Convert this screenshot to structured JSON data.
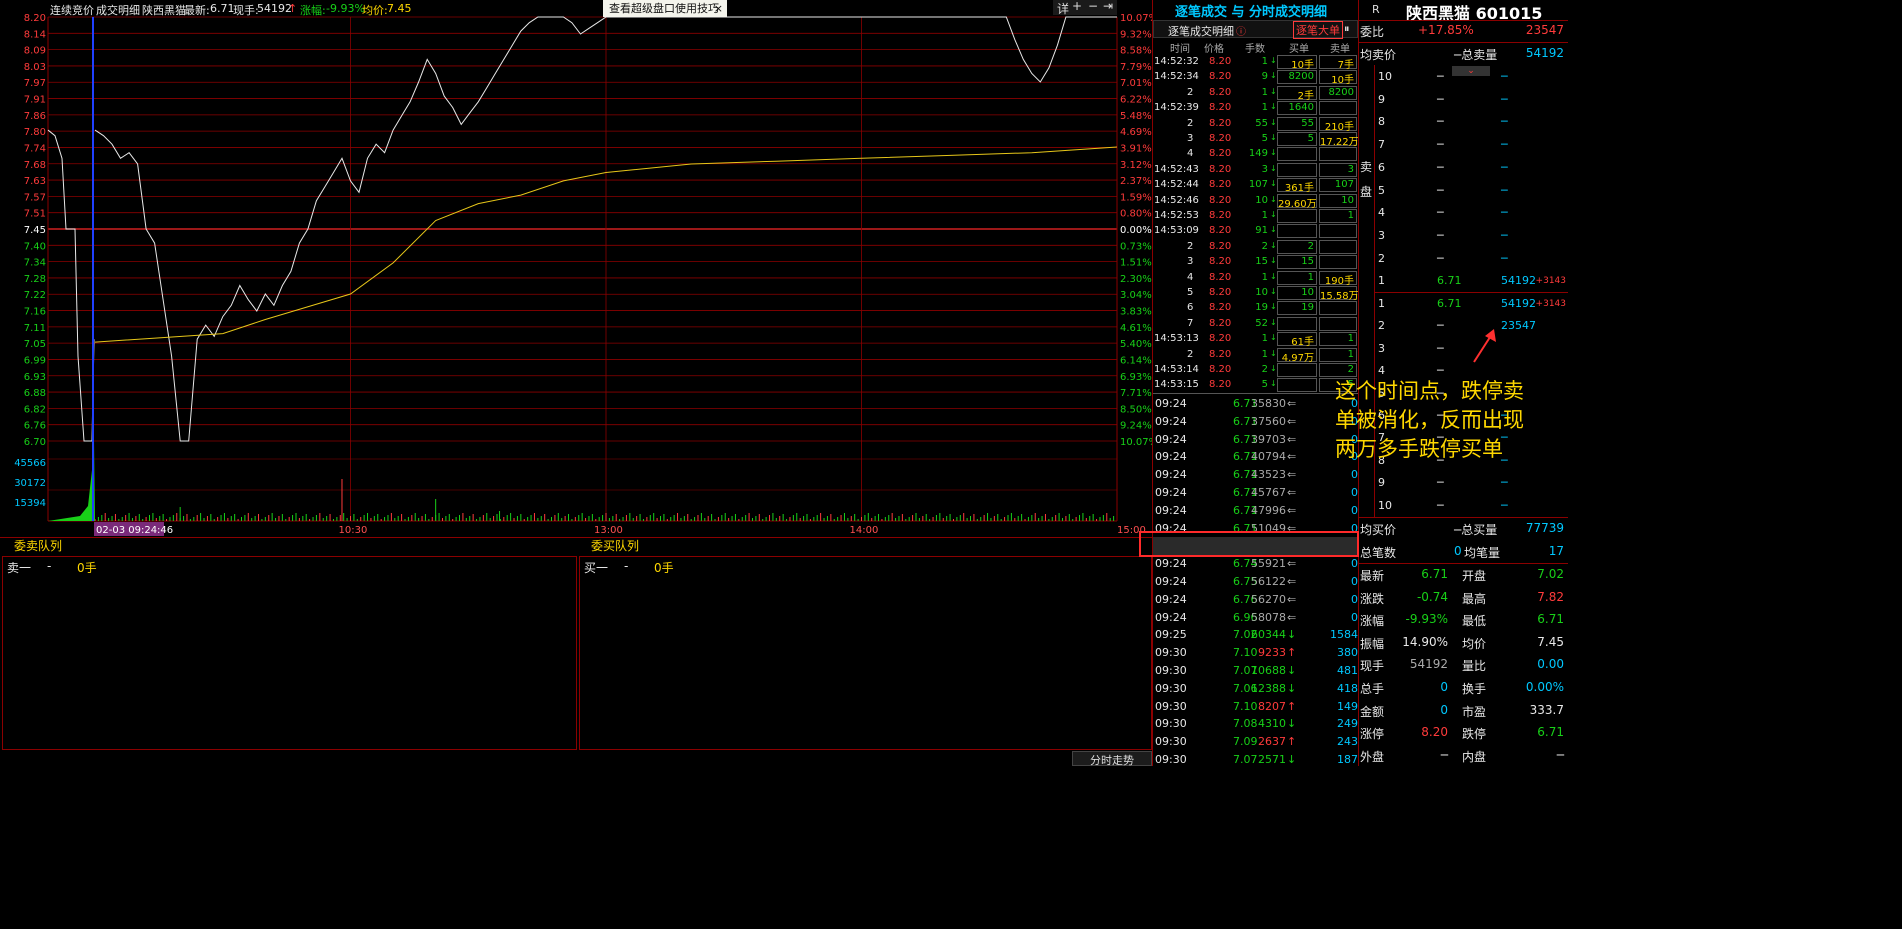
{
  "header": {
    "mode_label": "连续竞价",
    "detail_label": "成交明细",
    "stock_name": "陕西黑猫",
    "latest_label": "最新:",
    "latest_value": "6.71",
    "volume_label": "现手:",
    "volume_value": "54192",
    "change_label": "涨幅:",
    "change_value": "-9.93%",
    "avg_label": "均价:",
    "avg_value": "7.45",
    "tip_text": "查看超级盘口使用技巧",
    "tip_close": "×",
    "tool_detail": "详",
    "tool_plus": "+",
    "tool_minus": "−",
    "tool_expand": "⇥"
  },
  "colors": {
    "price_line": "#e8e8e8",
    "avg_line": "#e6c619",
    "grid": "#8b0000",
    "cursor": "#2040ff",
    "up": "#ff3b3b",
    "down": "#18d018"
  },
  "chart_data": {
    "type": "line",
    "title": "",
    "xlabel": "",
    "ylabel": "",
    "prev_close": 7.45,
    "ylim": [
      6.7,
      8.2
    ],
    "y_ticks": [
      "8.20",
      "8.14",
      "8.09",
      "8.03",
      "7.97",
      "7.91",
      "7.86",
      "7.80",
      "7.74",
      "7.68",
      "7.63",
      "7.57",
      "7.51",
      "7.45",
      "7.40",
      "7.34",
      "7.28",
      "7.22",
      "7.16",
      "7.11",
      "7.05",
      "6.99",
      "6.93",
      "6.88",
      "6.82",
      "6.76",
      "6.70"
    ],
    "pct_ticks": [
      "10.07%",
      "9.32%",
      "8.58%",
      "7.79%",
      "7.01%",
      "6.22%",
      "5.48%",
      "4.69%",
      "3.91%",
      "3.12%",
      "2.37%",
      "1.59%",
      "0.80%",
      "0.00%",
      "0.73%",
      "1.51%",
      "2.30%",
      "3.04%",
      "3.83%",
      "4.61%",
      "5.40%",
      "6.14%",
      "6.93%",
      "7.71%",
      "8.50%",
      "9.24%",
      "10.07%"
    ],
    "x_ticks": [
      "10:30",
      "13:00",
      "14:00",
      "15:00"
    ],
    "cursor_time": "02-03 09:24:46",
    "volume_ticks": [
      "45566",
      "30172",
      "15394"
    ],
    "series": [
      {
        "x": [
          0,
          2,
          4,
          6,
          8,
          10,
          12,
          14,
          16,
          18,
          20,
          22,
          24,
          26,
          28,
          30,
          32,
          34,
          36,
          38,
          40,
          42,
          44,
          46,
          48,
          50,
          52,
          54,
          56,
          58,
          60,
          62,
          64,
          66,
          68,
          70,
          72,
          74,
          76,
          78,
          80,
          82,
          84,
          86,
          88,
          90,
          92,
          94,
          96,
          98,
          100,
          102,
          104,
          106,
          108,
          110,
          112,
          114,
          116,
          118,
          120,
          122,
          124,
          126,
          128,
          130,
          132,
          134,
          136,
          138,
          140,
          142,
          144,
          146,
          148,
          150,
          152,
          154,
          156,
          158,
          160,
          162,
          164,
          166,
          168,
          170,
          172,
          174,
          176,
          178,
          180,
          182,
          184,
          186,
          188,
          190,
          192,
          194,
          196,
          198,
          200,
          202,
          204,
          206,
          208,
          210,
          212,
          214,
          216,
          218,
          220,
          222,
          224,
          226,
          228,
          230,
          232,
          234,
          236,
          238,
          240
        ],
        "values": [
          7.8,
          7.78,
          7.75,
          7.7,
          7.72,
          7.68,
          7.45,
          7.4,
          7.2,
          7.0,
          6.7,
          6.7,
          7.06,
          7.11,
          7.07,
          7.14,
          7.18,
          7.25,
          7.2,
          7.16,
          7.22,
          7.18,
          7.25,
          7.3,
          7.4,
          7.45,
          7.55,
          7.6,
          7.65,
          7.7,
          7.62,
          7.58,
          7.7,
          7.75,
          7.72,
          7.8,
          7.85,
          7.9,
          7.97,
          8.05,
          8.0,
          7.92,
          7.88,
          7.82,
          7.86,
          7.9,
          7.95,
          8.0,
          8.05,
          8.1,
          8.15,
          8.18,
          8.2,
          8.2,
          8.2,
          8.2,
          8.18,
          8.14,
          8.16,
          8.18,
          8.2,
          8.2,
          8.2,
          8.2,
          8.2,
          8.2,
          8.2,
          8.2,
          8.2,
          8.2,
          8.2,
          8.2,
          8.2,
          8.2,
          8.2,
          8.2,
          8.2,
          8.2,
          8.2,
          8.2,
          8.2,
          8.2,
          8.2,
          8.2,
          8.2,
          8.2,
          8.2,
          8.2,
          8.2,
          8.2,
          8.2,
          8.2,
          8.2,
          8.2,
          8.2,
          8.2,
          8.2,
          8.2,
          8.2,
          8.2,
          8.2,
          8.2,
          8.2,
          8.2,
          8.2,
          8.2,
          8.2,
          8.2,
          8.12,
          8.05,
          8.0,
          7.97,
          8.02,
          8.1,
          8.2,
          8.2,
          8.2,
          8.2,
          8.2,
          8.2,
          8.2
        ]
      },
      {
        "x": [
          0,
          30,
          40,
          60,
          70,
          80,
          90,
          100,
          110,
          120,
          140,
          160,
          180,
          200,
          220,
          240
        ],
        "values": [
          7.05,
          7.08,
          7.13,
          7.22,
          7.33,
          7.48,
          7.54,
          7.57,
          7.62,
          7.65,
          7.68,
          7.69,
          7.7,
          7.71,
          7.72,
          7.74
        ]
      }
    ]
  },
  "queues": {
    "sell_title": "委卖队列",
    "buy_title": "委买队列",
    "sell_line": {
      "label": "卖一",
      "dash": "-",
      "qty": "0手"
    },
    "buy_line": {
      "label": "买一",
      "dash": "-",
      "qty": "0手"
    }
  },
  "bottom_tab": "分时走势",
  "trades_panel": {
    "title": "逐笔成交 与 分时成交明细",
    "sub_title": "逐笔成交明细",
    "big_order": "逐笔大单",
    "cols": [
      "时间",
      "价格",
      "手数",
      "买单",
      "卖单"
    ],
    "rows": [
      {
        "t": "14:52:32",
        "p": "8.20",
        "q": "1"
      },
      {
        "t": "14:52:34",
        "p": "8.20",
        "q": "9"
      },
      {
        "t": "2",
        "p": "8.20",
        "q": "1"
      },
      {
        "t": "14:52:39",
        "p": "8.20",
        "q": "1"
      },
      {
        "t": "2",
        "p": "8.20",
        "q": "55"
      },
      {
        "t": "3",
        "p": "8.20",
        "q": "5"
      },
      {
        "t": "4",
        "p": "8.20",
        "q": "149"
      },
      {
        "t": "14:52:43",
        "p": "8.20",
        "q": "3"
      },
      {
        "t": "14:52:44",
        "p": "8.20",
        "q": "107"
      },
      {
        "t": "14:52:46",
        "p": "8.20",
        "q": "10"
      },
      {
        "t": "14:52:53",
        "p": "8.20",
        "q": "1"
      },
      {
        "t": "14:53:09",
        "p": "8.20",
        "q": "91"
      },
      {
        "t": "2",
        "p": "8.20",
        "q": "2"
      },
      {
        "t": "3",
        "p": "8.20",
        "q": "15"
      },
      {
        "t": "4",
        "p": "8.20",
        "q": "1"
      },
      {
        "t": "5",
        "p": "8.20",
        "q": "10"
      },
      {
        "t": "6",
        "p": "8.20",
        "q": "19"
      },
      {
        "t": "7",
        "p": "8.20",
        "q": "52"
      },
      {
        "t": "14:53:13",
        "p": "8.20",
        "q": "1"
      },
      {
        "t": "2",
        "p": "8.20",
        "q": "1"
      },
      {
        "t": "14:53:14",
        "p": "8.20",
        "q": "2"
      },
      {
        "t": "14:53:15",
        "p": "8.20",
        "q": "5"
      }
    ],
    "buy_col": [
      "10手",
      "8200",
      "2手",
      "1640",
      "55",
      "5",
      "",
      "",
      "361手",
      "29.60万",
      "",
      "",
      "2",
      "15",
      "1",
      "10",
      "19",
      "",
      "61手",
      "4.97万",
      "",
      ""
    ],
    "sell_col": [
      "7手",
      "10手",
      "8200",
      "",
      "210手",
      "17.22万",
      "",
      "3",
      "107",
      "10",
      "1",
      "",
      "",
      "",
      "190手",
      "15.58万",
      "",
      "",
      "1",
      "1",
      "2",
      "5"
    ]
  },
  "minute_trades": [
    {
      "t": "09:24",
      "p": "6.71",
      "v": "35830",
      "n": "0"
    },
    {
      "t": "09:24",
      "p": "6.71",
      "v": "37560",
      "n": "0"
    },
    {
      "t": "09:24",
      "p": "6.71",
      "v": "39703",
      "n": "0"
    },
    {
      "t": "09:24",
      "p": "6.71",
      "v": "40794",
      "n": "0"
    },
    {
      "t": "09:24",
      "p": "6.71",
      "v": "43523",
      "n": "0"
    },
    {
      "t": "09:24",
      "p": "6.71",
      "v": "45767",
      "n": "0"
    },
    {
      "t": "09:24",
      "p": "6.71",
      "v": "47996",
      "n": "0"
    },
    {
      "t": "09:24",
      "p": "6.71",
      "v": "51049",
      "n": "0"
    },
    {
      "t": "09:24",
      "p": "6.71",
      "v": "54192",
      "n": "0"
    },
    {
      "t": "09:24",
      "p": "6.74",
      "v": "55921",
      "n": "0"
    },
    {
      "t": "09:24",
      "p": "6.75",
      "v": "56122",
      "n": "0"
    },
    {
      "t": "09:24",
      "p": "6.76",
      "v": "56270",
      "n": "0"
    },
    {
      "t": "09:24",
      "p": "6.96",
      "v": "58078",
      "n": "0"
    },
    {
      "t": "09:25",
      "p": "7.02",
      "v": "60344",
      "n": "1584"
    },
    {
      "t": "09:30",
      "p": "7.10",
      "v": "9233",
      "n": "380"
    },
    {
      "t": "09:30",
      "p": "7.07",
      "v": "10688",
      "n": "481"
    },
    {
      "t": "09:30",
      "p": "7.06",
      "v": "12388",
      "n": "418"
    },
    {
      "t": "09:30",
      "p": "7.10",
      "v": "8207",
      "n": "149"
    },
    {
      "t": "09:30",
      "p": "7.08",
      "v": "4310",
      "n": "249"
    },
    {
      "t": "09:30",
      "p": "7.09",
      "v": "2637",
      "n": "243"
    },
    {
      "t": "09:30",
      "p": "7.07",
      "v": "2571",
      "n": "187"
    }
  ],
  "minute_dirs": [
    "l",
    "l",
    "l",
    "l",
    "l",
    "l",
    "l",
    "l",
    "l",
    "l",
    "l",
    "l",
    "l",
    "d",
    "u",
    "d",
    "d",
    "u",
    "d",
    "u",
    "d"
  ],
  "quote": {
    "r_label": "R",
    "name_code": "陕西黑猫 601015",
    "wb_label": "委比",
    "wb_pct": "+17.85%",
    "wb_diff": "23547",
    "avg_sell_label": "均卖价",
    "total_sell_label": "─总卖量",
    "total_sell_value": "54192",
    "sell_side_label": "卖",
    "sell_side_label2": "盘",
    "asks": [
      {
        "lv": "10",
        "p": "─",
        "v": "─"
      },
      {
        "lv": "9",
        "p": "─",
        "v": "─"
      },
      {
        "lv": "8",
        "p": "─",
        "v": "─"
      },
      {
        "lv": "7",
        "p": "─",
        "v": "─"
      },
      {
        "lv": "6",
        "p": "─",
        "v": "─"
      },
      {
        "lv": "5",
        "p": "─",
        "v": "─"
      },
      {
        "lv": "4",
        "p": "─",
        "v": "─"
      },
      {
        "lv": "3",
        "p": "─",
        "v": "─"
      },
      {
        "lv": "2",
        "p": "─",
        "v": "─"
      },
      {
        "lv": "1",
        "p": "6.71",
        "v": "54192",
        "c": "+3143"
      }
    ],
    "bids": [
      {
        "lv": "1",
        "p": "6.71",
        "v": "54192",
        "c": "+3143"
      },
      {
        "lv": "2",
        "p": "─",
        "v": "23547"
      },
      {
        "lv": "3",
        "p": "─",
        "v": ""
      },
      {
        "lv": "4",
        "p": "─",
        "v": ""
      },
      {
        "lv": "5",
        "p": "─",
        "v": ""
      },
      {
        "lv": "6",
        "p": "─",
        "v": "─"
      },
      {
        "lv": "7",
        "p": "─",
        "v": "─"
      },
      {
        "lv": "8",
        "p": "─",
        "v": "─"
      },
      {
        "lv": "9",
        "p": "─",
        "v": "─"
      },
      {
        "lv": "10",
        "p": "─",
        "v": "─"
      }
    ],
    "avg_buy_label": "均买价",
    "total_buy_label": "─总买量",
    "total_buy_value": "77739",
    "trade_count_label": "总笔数",
    "trade_count_value": "0",
    "avg_trade_label": "均笔量",
    "avg_trade_value": "17",
    "stats": [
      {
        "l1": "最新",
        "v1": "6.71",
        "l2": "开盘",
        "v2": "7.02"
      },
      {
        "l1": "涨跌",
        "v1": "-0.74",
        "l2": "最高",
        "v2": "7.82"
      },
      {
        "l1": "涨幅",
        "v1": "-9.93%",
        "l2": "最低",
        "v2": "6.71"
      },
      {
        "l1": "振幅",
        "v1": "14.90%",
        "l2": "均价",
        "v2": "7.45"
      },
      {
        "l1": "现手",
        "v1": "54192",
        "l2": "量比",
        "v2": "0.00"
      },
      {
        "l1": "总手",
        "v1": "0",
        "l2": "换手",
        "v2": "0.00%"
      },
      {
        "l1": "金额",
        "v1": "0",
        "l2": "市盈",
        "v2": "333.7"
      },
      {
        "l1": "涨停",
        "v1": "8.20",
        "l2": "跌停",
        "v2": "6.71"
      },
      {
        "l1": "外盘",
        "v1": "─",
        "l2": "内盘",
        "v2": "─"
      }
    ]
  },
  "annotation": {
    "line1": "这个时间点，跌停卖",
    "line2": "单被消化，反而出现",
    "line3": "两万多手跌停买单"
  }
}
